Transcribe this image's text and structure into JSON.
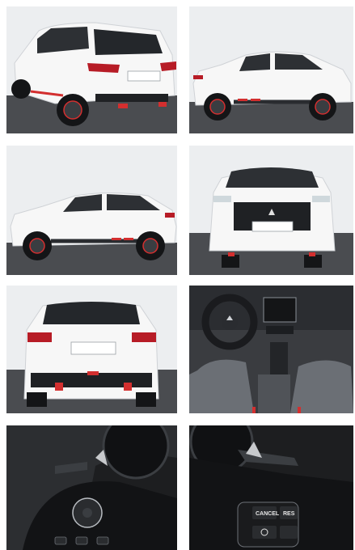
{
  "gallery": {
    "photos": [
      {
        "label": "rear-three-quarter-view"
      },
      {
        "label": "side-view-right"
      },
      {
        "label": "side-view-left"
      },
      {
        "label": "front-view"
      },
      {
        "label": "rear-view"
      },
      {
        "label": "interior-dashboard"
      },
      {
        "label": "steering-wheel-left-controls"
      },
      {
        "label": "steering-wheel-right-controls"
      }
    ],
    "wheel_buttons": {
      "cancel": "CANCEL",
      "res": "RES"
    }
  }
}
